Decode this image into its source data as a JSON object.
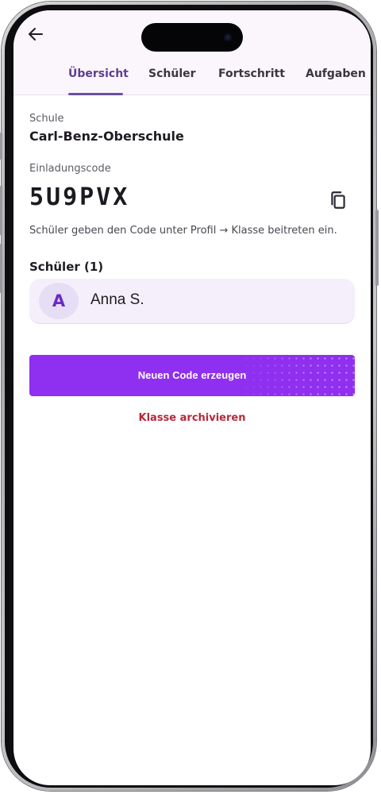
{
  "header": {
    "back_icon": "arrow-left-icon",
    "tabs": [
      {
        "label": "Übersicht",
        "active": true
      },
      {
        "label": "Schüler",
        "active": false
      },
      {
        "label": "Fortschritt",
        "active": false
      },
      {
        "label": "Aufgaben",
        "active": false
      }
    ]
  },
  "school": {
    "label": "Schule",
    "name": "Carl-Benz-Oberschule"
  },
  "invite": {
    "label": "Einladungscode",
    "code": "5U9PVX",
    "copy_icon": "copy-icon",
    "hint": "Schüler geben den Code unter Profil → Klasse beitreten ein."
  },
  "students": {
    "title": "Schüler (1)",
    "items": [
      {
        "initial": "A",
        "name": "Anna S."
      }
    ]
  },
  "actions": {
    "generate_label": "Neuen Code erzeugen",
    "archive_label": "Klasse archivieren"
  },
  "colors": {
    "accent": "#8f2fef",
    "tab_active": "#5c3f8f",
    "danger": "#b5293a"
  }
}
